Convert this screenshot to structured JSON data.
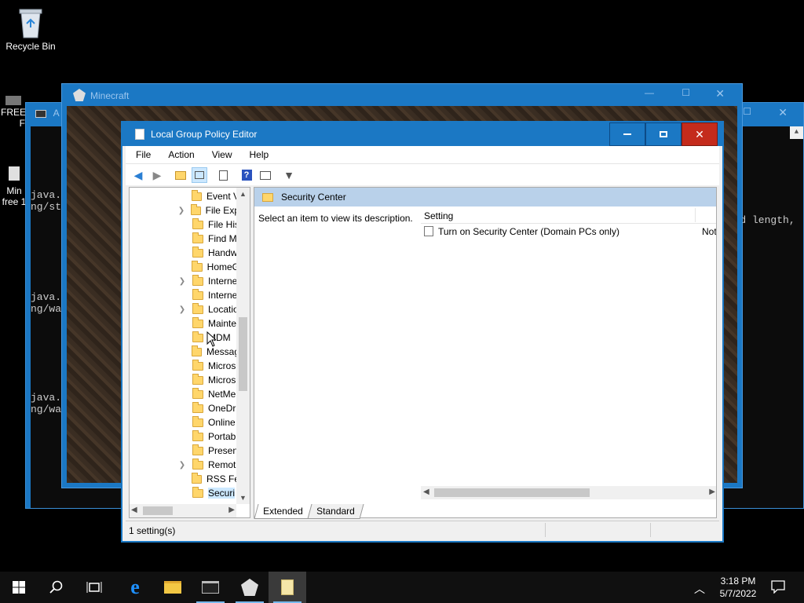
{
  "desktop": {
    "recycle_bin_label": "Recycle Bin",
    "icon2_label_1": "FREE",
    "icon2_label_2": "F",
    "icon3_label_1": "Min",
    "icon3_label_2": "free 1"
  },
  "console": {
    "title": "A",
    "lines": [
      "java.",
      "ng/st",
      "java.",
      "ng/wa",
      "java.",
      "ng/wa"
    ],
    "right_text": "word length,"
  },
  "minecraft": {
    "title": "Minecraft"
  },
  "gpe": {
    "title": "Local Group Policy Editor",
    "menu": [
      "File",
      "Action",
      "View",
      "Help"
    ],
    "tree": [
      {
        "label": "Event V",
        "expandable": false
      },
      {
        "label": "File Exp",
        "expandable": true
      },
      {
        "label": "File His",
        "expandable": false
      },
      {
        "label": "Find M",
        "expandable": false
      },
      {
        "label": "Handw",
        "expandable": false
      },
      {
        "label": "HomeG",
        "expandable": false
      },
      {
        "label": "Interne",
        "expandable": true
      },
      {
        "label": "Interne",
        "expandable": false
      },
      {
        "label": "Locatio",
        "expandable": true
      },
      {
        "label": "Mainte",
        "expandable": false
      },
      {
        "label": "MDM",
        "expandable": false
      },
      {
        "label": "Messag",
        "expandable": false
      },
      {
        "label": "Micros",
        "expandable": false
      },
      {
        "label": "Micros",
        "expandable": false
      },
      {
        "label": "NetMe",
        "expandable": false
      },
      {
        "label": "OneDr",
        "expandable": false
      },
      {
        "label": "Online",
        "expandable": false
      },
      {
        "label": "Portab",
        "expandable": false
      },
      {
        "label": "Presen",
        "expandable": false
      },
      {
        "label": "Remot",
        "expandable": true
      },
      {
        "label": "RSS Fe",
        "expandable": false
      },
      {
        "label": "Securi",
        "expandable": false,
        "selected": true
      }
    ],
    "right_header": "Security Center",
    "description": "Select an item to view its description.",
    "columns": {
      "setting": "Setting"
    },
    "rows": [
      {
        "setting": "Turn on Security Center (Domain PCs only)",
        "state": "Not"
      }
    ],
    "tabs": [
      "Extended",
      "Standard"
    ],
    "status": "1 setting(s)"
  },
  "taskbar": {
    "time": "3:18 PM",
    "date": "5/7/2022"
  },
  "colors": {
    "accent": "#1b78c4",
    "close_hover": "#c42b1c",
    "header_bg": "#b9d1ea"
  }
}
